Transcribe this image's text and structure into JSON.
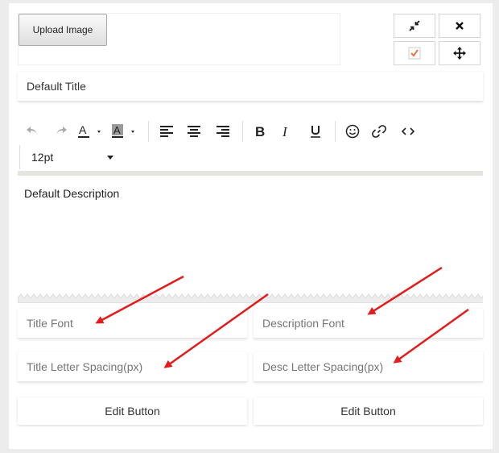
{
  "upload": {
    "button_label": "Upload Image"
  },
  "controls": {
    "minimize_icon": "compress-icon",
    "close_icon": "close-icon",
    "confirm_icon": "checkbox-checked-icon",
    "move_icon": "move-icon"
  },
  "title_field": {
    "value": "Default Title"
  },
  "editor": {
    "font_size": "12pt",
    "description": "Default Description",
    "toolbar_icons": [
      "undo-icon",
      "redo-icon",
      "text-color-icon",
      "background-color-icon",
      "align-left-icon",
      "align-center-icon",
      "align-right-icon",
      "bold-icon",
      "italic-icon",
      "underline-icon",
      "emoticon-icon",
      "link-icon",
      "source-code-icon"
    ]
  },
  "fields": {
    "title_font": "Title Font",
    "description_font": "Description Font",
    "title_letter_spacing": "Title Letter Spacing(px)",
    "desc_letter_spacing": "Desc Letter Spacing(px)"
  },
  "buttons": {
    "edit_left": "Edit Button",
    "edit_right": "Edit Button"
  },
  "colors": {
    "arrow": "#e31b1b",
    "check": "#e8763a"
  }
}
